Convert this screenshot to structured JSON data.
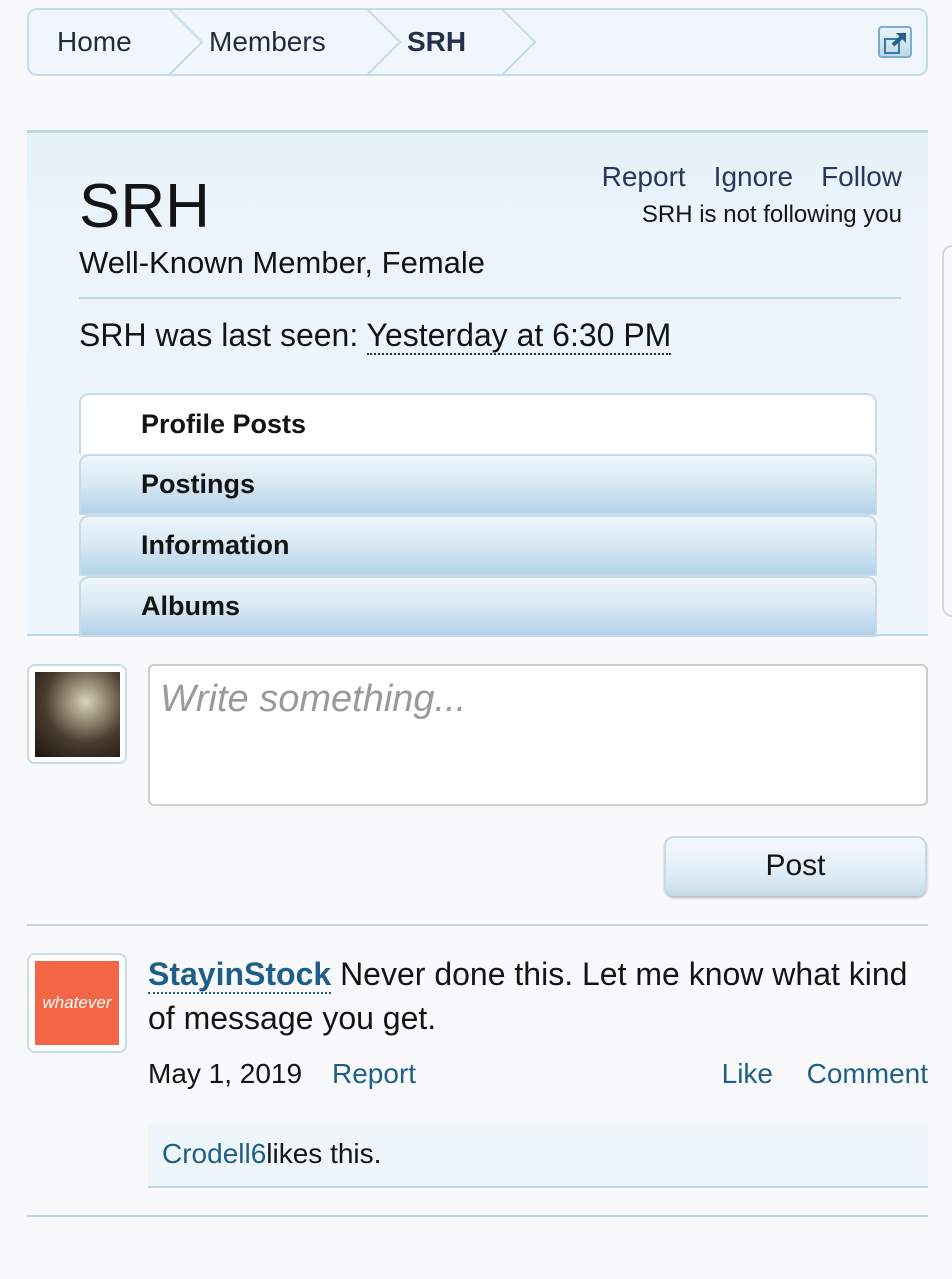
{
  "breadcrumb": {
    "items": [
      "Home",
      "Members",
      "SRH"
    ]
  },
  "icons": {
    "jump": "external-link-icon"
  },
  "profile": {
    "username": "SRH",
    "title": "Well-Known Member, Female",
    "actions": {
      "report": "Report",
      "ignore": "Ignore",
      "follow": "Follow"
    },
    "follow_status": "SRH is not following you",
    "last_seen_prefix": "SRH was last seen: ",
    "last_seen_time": "Yesterday at 6:30 PM",
    "tabs": [
      "Profile Posts",
      "Postings",
      "Information",
      "Albums"
    ]
  },
  "composer": {
    "placeholder": "Write something...",
    "post_label": "Post"
  },
  "posts": [
    {
      "author": "StayinStock",
      "avatar_text": "whatever",
      "avatar_color": "#f26645",
      "message": " Never done this. Let me know what kind of message you get.",
      "date": "May 1, 2019",
      "report": "Report",
      "like": "Like",
      "comment": "Comment",
      "likes": {
        "user": "Crodell6",
        "suffix": " likes this."
      }
    }
  ],
  "colors": {
    "accent_link": "#1d5f87",
    "border": "#c5dbe8",
    "card_bg": "#eef6fc"
  }
}
